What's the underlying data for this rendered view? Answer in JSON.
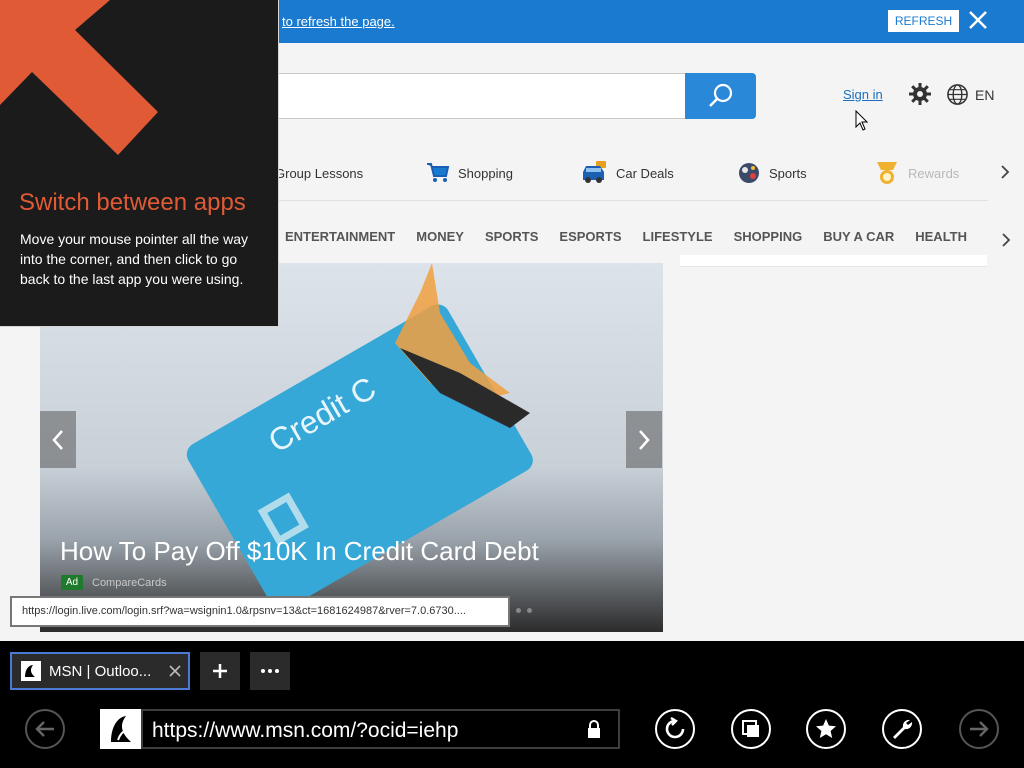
{
  "notification": {
    "text": "to refresh the page.",
    "refresh_label": "REFRESH"
  },
  "header": {
    "sign_in": "Sign in",
    "language": "EN"
  },
  "quick_links": [
    {
      "label": "Group Lessons",
      "icon": "group-icon"
    },
    {
      "label": "Shopping",
      "icon": "cart-icon"
    },
    {
      "label": "Car Deals",
      "icon": "car-icon"
    },
    {
      "label": "Sports",
      "icon": "ball-icon"
    },
    {
      "label": "Rewards",
      "icon": "medal-icon"
    }
  ],
  "categories": [
    "ENTERTAINMENT",
    "MONEY",
    "SPORTS",
    "ESPORTS",
    "LIFESTYLE",
    "SHOPPING",
    "BUY A CAR",
    "HEALTH"
  ],
  "hero": {
    "title": "How To Pay Off $10K In Credit Card Debt",
    "ad_badge": "Ad",
    "source": "CompareCards",
    "image_text": "Credit C"
  },
  "status_url": "https://login.live.com/login.srf?wa=wsignin1.0&rpsnv=13&ct=1681624987&rver=7.0.6730....",
  "overlay": {
    "title": "Switch between apps",
    "body": "Move your mouse pointer all the way into the corner, and then click to go back to the last app you were using."
  },
  "browser": {
    "tab_label": "MSN | Outloo...",
    "url": "https://www.msn.com/?ocid=iehp"
  },
  "colors": {
    "accent": "#1a7ad0",
    "overlay_title": "#e05a35",
    "tab_border": "#4b7bd6"
  }
}
